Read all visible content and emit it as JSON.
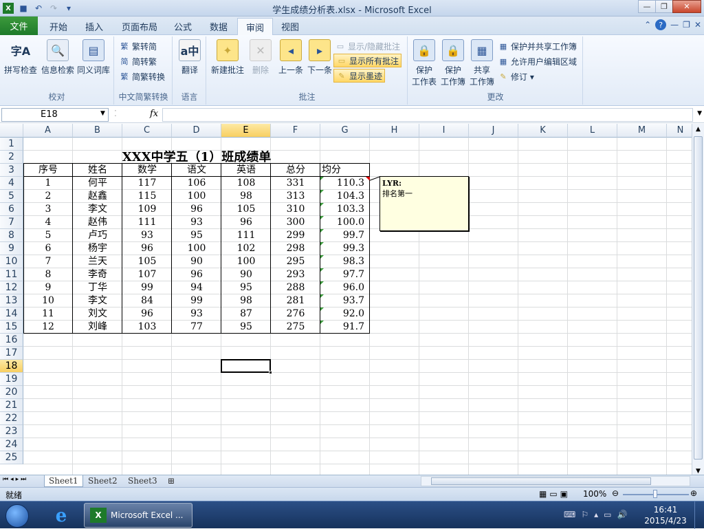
{
  "window": {
    "title": "学生成绩分析表.xlsx - Microsoft Excel"
  },
  "qat": {
    "save_icon": "save-icon",
    "undo_icon": "undo-icon",
    "redo_icon": "redo-icon",
    "more_icon": "chevron-down-icon"
  },
  "tabs": [
    {
      "label": "文件"
    },
    {
      "label": "开始"
    },
    {
      "label": "插入"
    },
    {
      "label": "页面布局"
    },
    {
      "label": "公式"
    },
    {
      "label": "数据"
    },
    {
      "label": "审阅",
      "active": true
    },
    {
      "label": "视图"
    }
  ],
  "ribbon": {
    "proof": {
      "label": "校对",
      "spell": "拼写检查",
      "research": "信息检索",
      "thesaurus": "同义词库"
    },
    "chinese": {
      "label": "中文简繁转换",
      "t2s": "繁转简",
      "s2t": "简转繁",
      "convert": "简繁转换"
    },
    "language": {
      "label": "语言",
      "translate": "翻译"
    },
    "comments": {
      "label": "批注",
      "new": "新建批注",
      "delete": "删除",
      "prev": "上一条",
      "next": "下一条",
      "toggle": "显示/隐藏批注",
      "showall": "显示所有批注",
      "ink": "显示墨迹"
    },
    "changes": {
      "label": "更改",
      "protect_sheet": "保护\n工作表",
      "protect_sheet_a": "保护",
      "protect_sheet_b": "工作表",
      "protect_book_a": "保护",
      "protect_book_b": "工作簿",
      "share_a": "共享",
      "share_b": "工作簿",
      "protect_share": "保护并共享工作簿",
      "allow_edit": "允许用户编辑区域",
      "track": "修订 ▾"
    }
  },
  "formula_bar": {
    "name_box": "E18",
    "fx": "fx",
    "content": ""
  },
  "columns": [
    "A",
    "B",
    "C",
    "D",
    "E",
    "F",
    "G",
    "H",
    "I",
    "J",
    "K",
    "L",
    "M",
    "N"
  ],
  "rows": [
    "1",
    "2",
    "3",
    "4",
    "5",
    "6",
    "7",
    "8",
    "9",
    "10",
    "11",
    "12",
    "13",
    "14",
    "15",
    "16",
    "17",
    "18",
    "19",
    "20",
    "21",
    "22",
    "23",
    "24",
    "25"
  ],
  "sheet": {
    "title": "XXX中学五（1）班成绩单",
    "headers": [
      "序号",
      "姓名",
      "数学",
      "语文",
      "英语",
      "总分",
      "均分"
    ],
    "data": [
      [
        "1",
        "何平",
        "117",
        "106",
        "108",
        "331",
        "110.3"
      ],
      [
        "2",
        "赵鑫",
        "115",
        "100",
        "98",
        "313",
        "104.3"
      ],
      [
        "3",
        "李文",
        "109",
        "96",
        "105",
        "310",
        "103.3"
      ],
      [
        "4",
        "赵伟",
        "111",
        "93",
        "96",
        "300",
        "100.0"
      ],
      [
        "5",
        "卢巧",
        "93",
        "95",
        "111",
        "299",
        "99.7"
      ],
      [
        "6",
        "杨宇",
        "96",
        "100",
        "102",
        "298",
        "99.3"
      ],
      [
        "7",
        "兰天",
        "105",
        "90",
        "100",
        "295",
        "98.3"
      ],
      [
        "8",
        "李奇",
        "107",
        "96",
        "90",
        "293",
        "97.7"
      ],
      [
        "9",
        "丁华",
        "99",
        "94",
        "95",
        "288",
        "96.0"
      ],
      [
        "10",
        "李文",
        "84",
        "99",
        "98",
        "281",
        "93.7"
      ],
      [
        "11",
        "刘文",
        "96",
        "93",
        "87",
        "276",
        "92.0"
      ],
      [
        "12",
        "刘峰",
        "103",
        "77",
        "95",
        "275",
        "91.7"
      ]
    ]
  },
  "comment": {
    "author": "LYR:",
    "text": "排名第一"
  },
  "sheet_tabs": [
    "Sheet1",
    "Sheet2",
    "Sheet3"
  ],
  "status": {
    "ready": "就绪",
    "zoom": "100%"
  },
  "taskbar": {
    "app": "Microsoft Excel ...",
    "time": "16:41",
    "date": "2015/4/23"
  }
}
